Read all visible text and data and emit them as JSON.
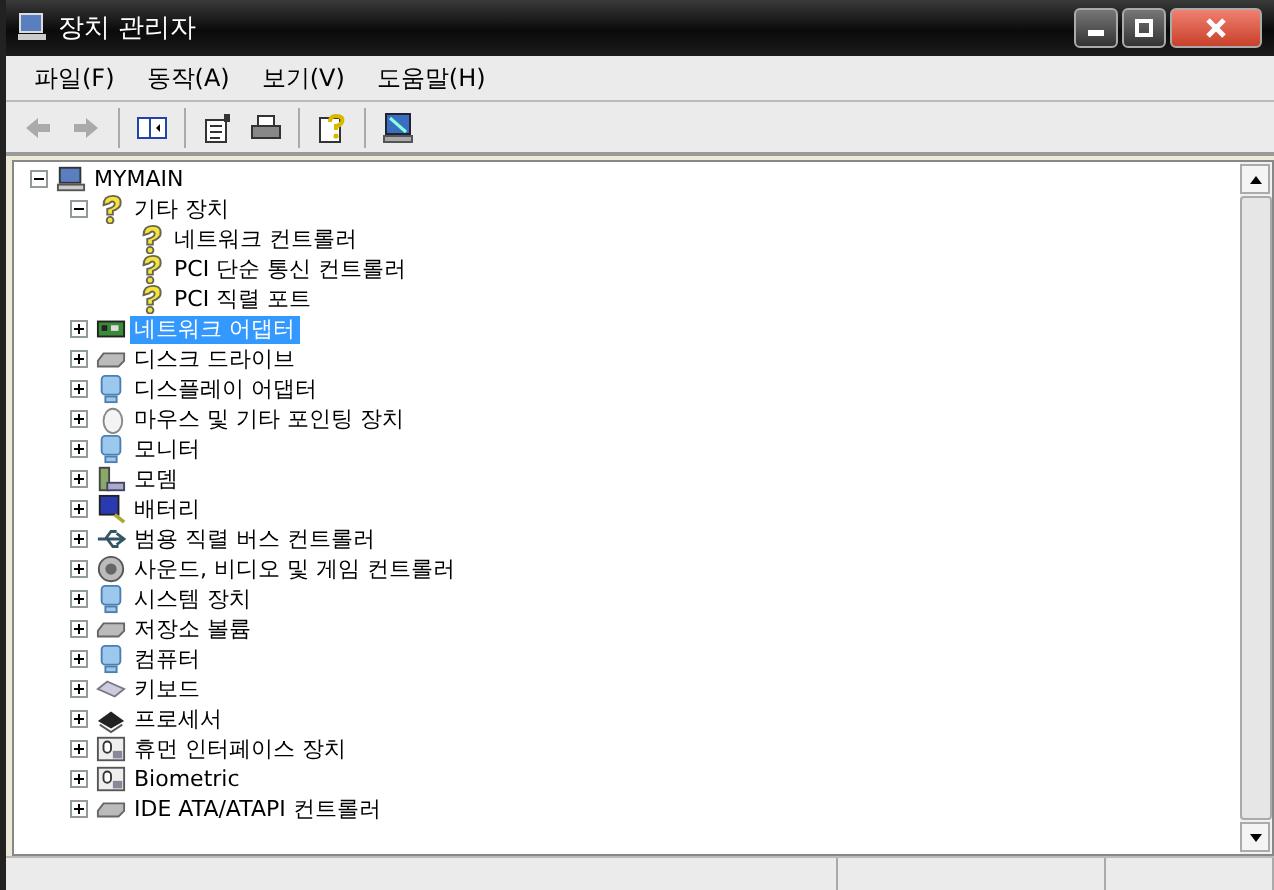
{
  "window": {
    "title": "장치 관리자"
  },
  "menu": [
    "파일(F)",
    "동작(A)",
    "보기(V)",
    "도움말(H)"
  ],
  "tree": [
    {
      "label": "MYMAIN",
      "expanded": true,
      "selected": false,
      "children": [
        {
          "label": "기타 장치",
          "expanded": true,
          "selected": false,
          "children": [
            {
              "label": "네트워크 컨트롤러",
              "selected": false
            },
            {
              "label": "PCI 단순 통신 컨트롤러",
              "selected": false
            },
            {
              "label": "PCI 직렬 포트",
              "selected": false
            }
          ]
        },
        {
          "label": "네트워크 어댑터",
          "expanded": false,
          "selected": true
        },
        {
          "label": "디스크 드라이브",
          "expanded": false,
          "selected": false
        },
        {
          "label": "디스플레이 어댑터",
          "expanded": false,
          "selected": false
        },
        {
          "label": "마우스 및 기타 포인팅 장치",
          "expanded": false,
          "selected": false
        },
        {
          "label": "모니터",
          "expanded": false,
          "selected": false
        },
        {
          "label": "모뎀",
          "expanded": false,
          "selected": false
        },
        {
          "label": "배터리",
          "expanded": false,
          "selected": false
        },
        {
          "label": "범용 직렬 버스 컨트롤러",
          "expanded": false,
          "selected": false
        },
        {
          "label": "사운드, 비디오 및 게임 컨트롤러",
          "expanded": false,
          "selected": false
        },
        {
          "label": "시스템 장치",
          "expanded": false,
          "selected": false
        },
        {
          "label": "저장소 볼륨",
          "expanded": false,
          "selected": false
        },
        {
          "label": "컴퓨터",
          "expanded": false,
          "selected": false
        },
        {
          "label": "키보드",
          "expanded": false,
          "selected": false
        },
        {
          "label": "프로세서",
          "expanded": false,
          "selected": false
        },
        {
          "label": "휴먼 인터페이스 장치",
          "expanded": false,
          "selected": false
        },
        {
          "label": "Biometric",
          "expanded": false,
          "selected": false
        },
        {
          "label": "IDE ATA/ATAPI 컨트롤러",
          "expanded": false,
          "selected": false
        }
      ]
    }
  ]
}
